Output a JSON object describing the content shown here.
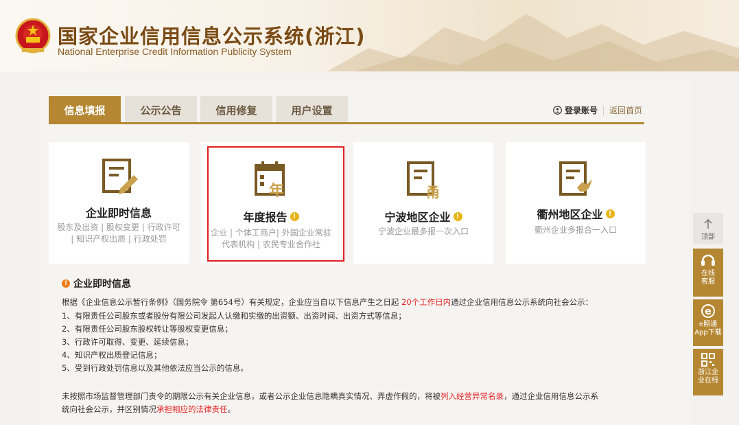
{
  "header": {
    "title": "国家企业信用信息公示系统(浙江)",
    "subtitle": "National Enterprise Credit Information Publicity System"
  },
  "tabs": [
    {
      "label": "信息填报",
      "active": true
    },
    {
      "label": "公示公告",
      "active": false
    },
    {
      "label": "信用修复",
      "active": false
    },
    {
      "label": "用户设置",
      "active": false
    }
  ],
  "top_links": {
    "login": "登录账号",
    "home": "返回首页"
  },
  "cards": [
    {
      "title": "企业即时信息",
      "desc": "股东及出资 | 股权变更 | 行政许可 | 知识产权出质 | 行政处罚",
      "icon": "document-edit-icon",
      "warn": false
    },
    {
      "title": "年度报告",
      "desc": "企业 | 个体工商户| 外国企业常驻代表机构 | 农民专业合作社",
      "icon": "calendar-year-icon",
      "warn": true
    },
    {
      "title": "宁波地区企业",
      "desc": "宁波企业最多报一次入口",
      "icon": "document-yong-icon",
      "warn": true
    },
    {
      "title": "衢州地区企业",
      "desc": "衢州企业多报合一入口",
      "icon": "document-bird-icon",
      "warn": true
    }
  ],
  "info": {
    "heading": "企业即时信息",
    "intro_before": "根据《企业信息公示暂行条例》（国务院令 第654号）有关规定，企业应当自以下信息产生之日起 ",
    "intro_red": "20个工作日内",
    "intro_after": "通过企业信用信息公示系统向社会公示：",
    "items": [
      "1、有限责任公司股东或者股份有限公司发起人认缴和实缴的出资额、出资时间、出资方式等信息；",
      "2、有限责任公司股东股权转让等股权变更信息；",
      "3、行政许可取得、变更、延续信息；",
      "4、知识产权出质登记信息；",
      "5、受到行政处罚信息以及其他依法应当公示的信息。"
    ],
    "note_a": "未按照市场监督管理部门责令的期限公示有关企业信息，或者公示企业信息隐瞒真实情况、弄虚作假的，将被",
    "note_red1": "列入经营异常名录",
    "note_b": "，通过企业信用信息公示系",
    "note_c": "统向社会公示，并区别情况",
    "note_red2": "承担相应的法律责任",
    "note_d": "。"
  },
  "float_bar": {
    "top": "顶部",
    "service": "在线客服",
    "app": "e照通App下载",
    "online": "浙江企业在线"
  },
  "colors": {
    "accent": "#b58733",
    "warn": "#e8b414",
    "alert": "#e02020",
    "brand_text": "#7a4a14"
  }
}
